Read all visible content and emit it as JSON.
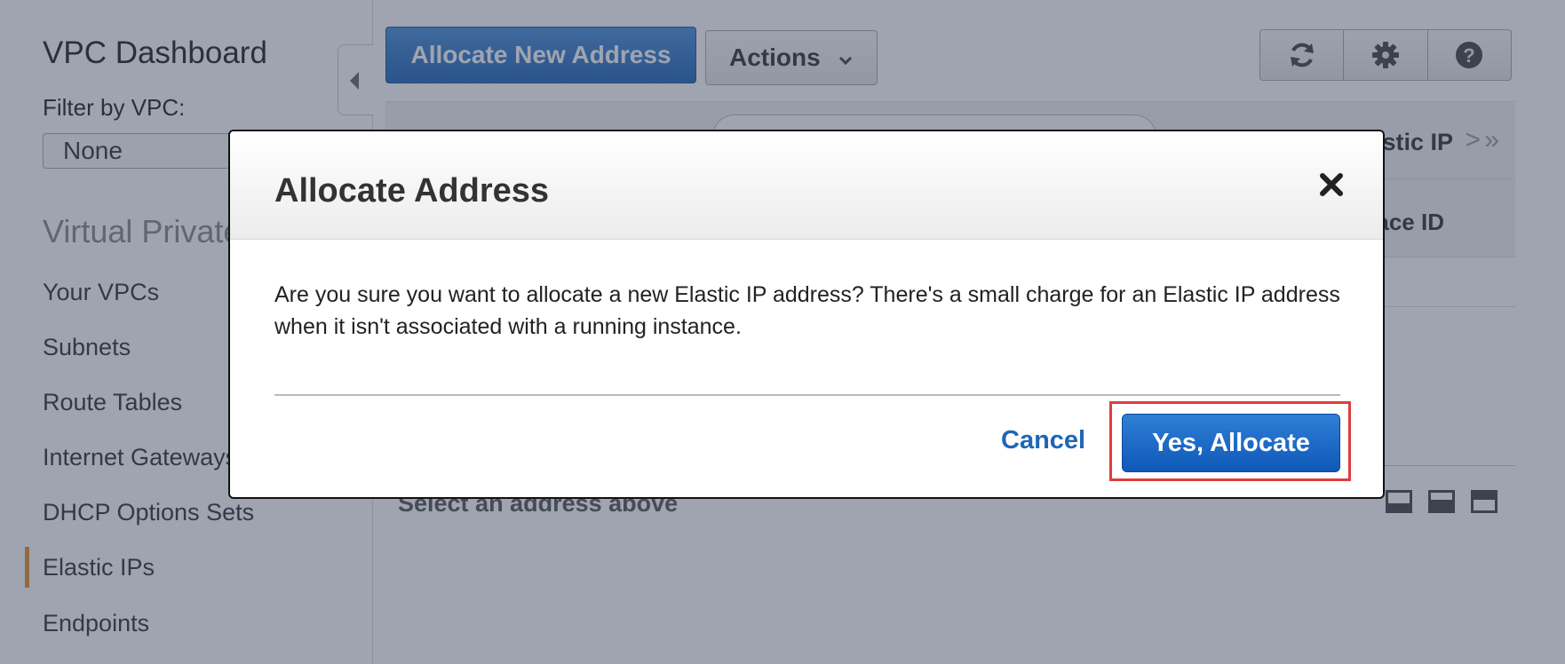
{
  "sidebar": {
    "title": "VPC Dashboard",
    "filter_label": "Filter by VPC:",
    "filter_value": "None",
    "section_title": "Virtual Private Cloud",
    "items": [
      {
        "label": "Your VPCs"
      },
      {
        "label": "Subnets"
      },
      {
        "label": "Route Tables"
      },
      {
        "label": "Internet Gateways"
      },
      {
        "label": "DHCP Options Sets"
      },
      {
        "label": "Elastic IPs",
        "active": true
      },
      {
        "label": "Endpoints"
      }
    ]
  },
  "toolbar": {
    "allocate_label": "Allocate New Address",
    "actions_label": "Actions"
  },
  "table": {
    "col_elastic_ip": "Elastic IP",
    "col_interface_id": "Interface ID",
    "pager": "> »"
  },
  "detail": {
    "placeholder": "Select an address above"
  },
  "modal": {
    "title": "Allocate Address",
    "body": "Are you sure you want to allocate a new Elastic IP address? There's a small charge for an Elastic IP address when it isn't associated with a running instance.",
    "cancel_label": "Cancel",
    "confirm_label": "Yes, Allocate"
  },
  "colors": {
    "primary_button": "#1f66b8",
    "highlight": "#e03c3c",
    "active_marker": "#e8912d"
  }
}
